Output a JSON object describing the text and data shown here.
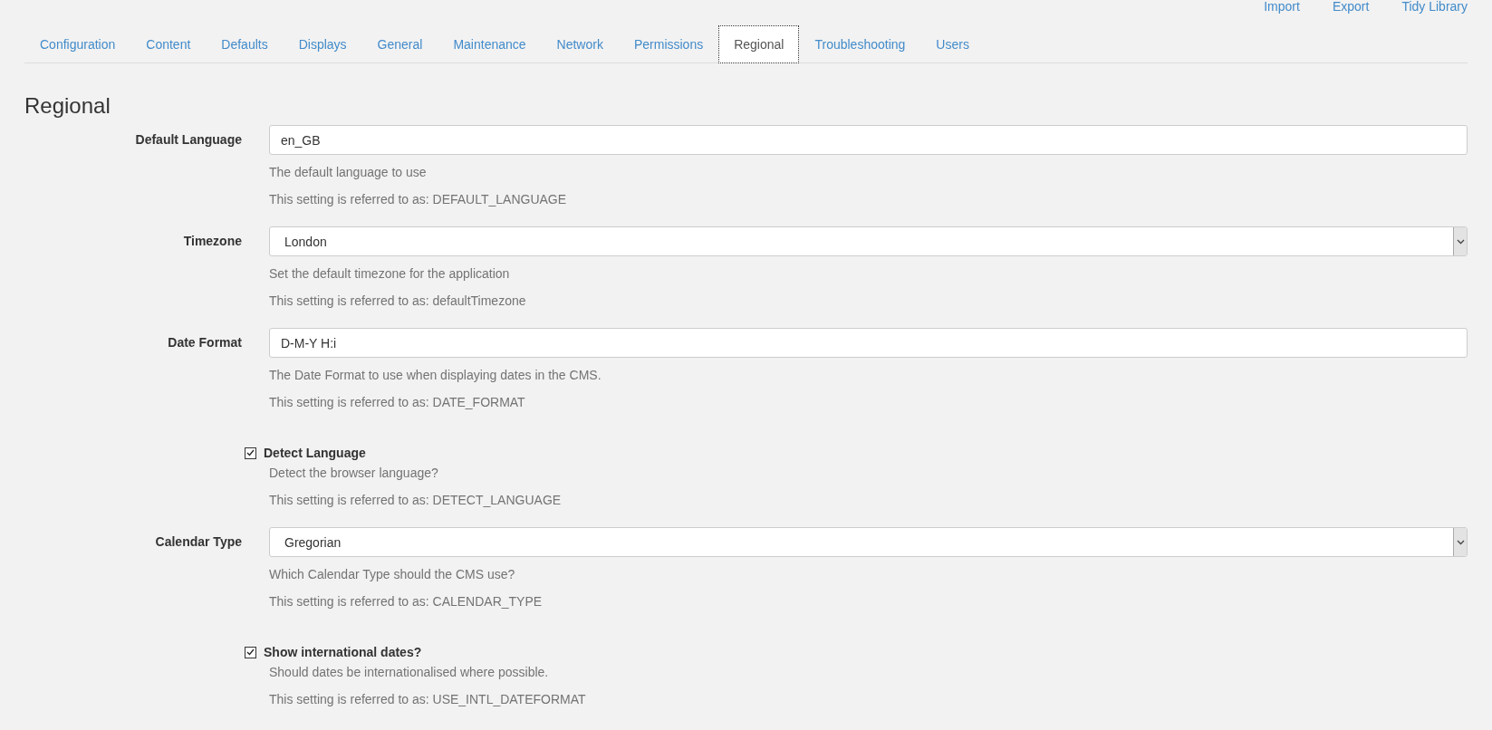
{
  "top_links": [
    "Import",
    "Export",
    "Tidy Library"
  ],
  "tabs": [
    {
      "label": "Configuration",
      "selected": false
    },
    {
      "label": "Content",
      "selected": false
    },
    {
      "label": "Defaults",
      "selected": false
    },
    {
      "label": "Displays",
      "selected": false
    },
    {
      "label": "General",
      "selected": false
    },
    {
      "label": "Maintenance",
      "selected": false
    },
    {
      "label": "Network",
      "selected": false
    },
    {
      "label": "Permissions",
      "selected": false
    },
    {
      "label": "Regional",
      "selected": true
    },
    {
      "label": "Troubleshooting",
      "selected": false
    },
    {
      "label": "Users",
      "selected": false
    }
  ],
  "heading": "Regional",
  "settings": [
    {
      "kind": "text",
      "label": "Default Language",
      "value": "en_GB",
      "help": "The default language to use",
      "reference": "This setting is referred to as: DEFAULT_LANGUAGE"
    },
    {
      "kind": "select",
      "label": "Timezone",
      "value": "London",
      "help": "Set the default timezone for the application",
      "reference": "This setting is referred to as: defaultTimezone"
    },
    {
      "kind": "text",
      "label": "Date Format",
      "value": "D-M-Y H:i",
      "help": "The Date Format to use when displaying dates in the CMS.",
      "reference": "This setting is referred to as: DATE_FORMAT"
    },
    {
      "kind": "checkbox",
      "label": "Detect Language",
      "checked": true,
      "help": "Detect the browser language?",
      "reference": "This setting is referred to as: DETECT_LANGUAGE"
    },
    {
      "kind": "select",
      "label": "Calendar Type",
      "value": "Gregorian",
      "help": "Which Calendar Type should the CMS use?",
      "reference": "This setting is referred to as: CALENDAR_TYPE"
    },
    {
      "kind": "checkbox",
      "label": "Show international dates?",
      "checked": true,
      "help": "Should dates be internationalised where possible.",
      "reference": "This setting is referred to as: USE_INTL_DATEFORMAT"
    }
  ]
}
